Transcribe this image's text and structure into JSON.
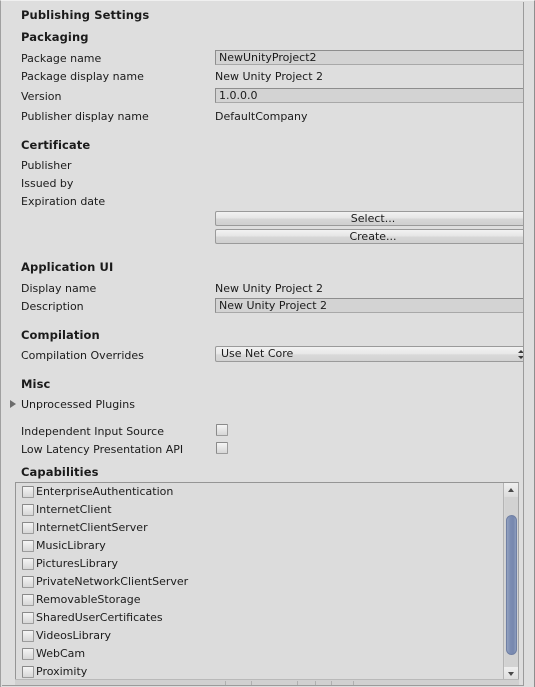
{
  "panel": {
    "title": "Publishing Settings"
  },
  "packaging": {
    "heading": "Packaging",
    "rows": [
      {
        "label": "Package name",
        "value": "NewUnityProject2",
        "type": "field"
      },
      {
        "label": "Package display name",
        "value": "New Unity Project 2",
        "type": "text"
      },
      {
        "label": "Version",
        "value": "1.0.0.0",
        "type": "field"
      },
      {
        "label": "Publisher display name",
        "value": "DefaultCompany",
        "type": "text"
      }
    ]
  },
  "certificate": {
    "heading": "Certificate",
    "rows": [
      {
        "label": "Publisher",
        "value": ""
      },
      {
        "label": "Issued by",
        "value": ""
      },
      {
        "label": "Expiration date",
        "value": ""
      }
    ],
    "select_button": "Select...",
    "create_button": "Create..."
  },
  "application_ui": {
    "heading": "Application UI",
    "rows": [
      {
        "label": "Display name",
        "value": "New Unity Project 2",
        "type": "text"
      },
      {
        "label": "Description",
        "value": "New Unity Project 2",
        "type": "field"
      }
    ]
  },
  "compilation": {
    "heading": "Compilation",
    "overrides_label": "Compilation Overrides",
    "overrides_value": "Use Net Core"
  },
  "misc": {
    "heading": "Misc",
    "unprocessed_plugins_label": "Unprocessed Plugins",
    "unprocessed_plugins_expanded": false,
    "toggles": [
      {
        "label": "Independent Input Source",
        "checked": false
      },
      {
        "label": "Low Latency Presentation API",
        "checked": false
      }
    ]
  },
  "capabilities": {
    "heading": "Capabilities",
    "items": [
      {
        "label": "EnterpriseAuthentication",
        "checked": false
      },
      {
        "label": "InternetClient",
        "checked": false
      },
      {
        "label": "InternetClientServer",
        "checked": false
      },
      {
        "label": "MusicLibrary",
        "checked": false
      },
      {
        "label": "PicturesLibrary",
        "checked": false
      },
      {
        "label": "PrivateNetworkClientServer",
        "checked": false
      },
      {
        "label": "RemovableStorage",
        "checked": false
      },
      {
        "label": "SharedUserCertificates",
        "checked": false
      },
      {
        "label": "VideosLibrary",
        "checked": false
      },
      {
        "label": "WebCam",
        "checked": false
      },
      {
        "label": "Proximity",
        "checked": false
      }
    ]
  },
  "colors": {
    "panel_background": "#dedede",
    "field_background": "#d3d3d3",
    "text": "#1b1b1b",
    "scrollbar_thumb": "#7c8db3",
    "border": "#a5a5a5"
  }
}
